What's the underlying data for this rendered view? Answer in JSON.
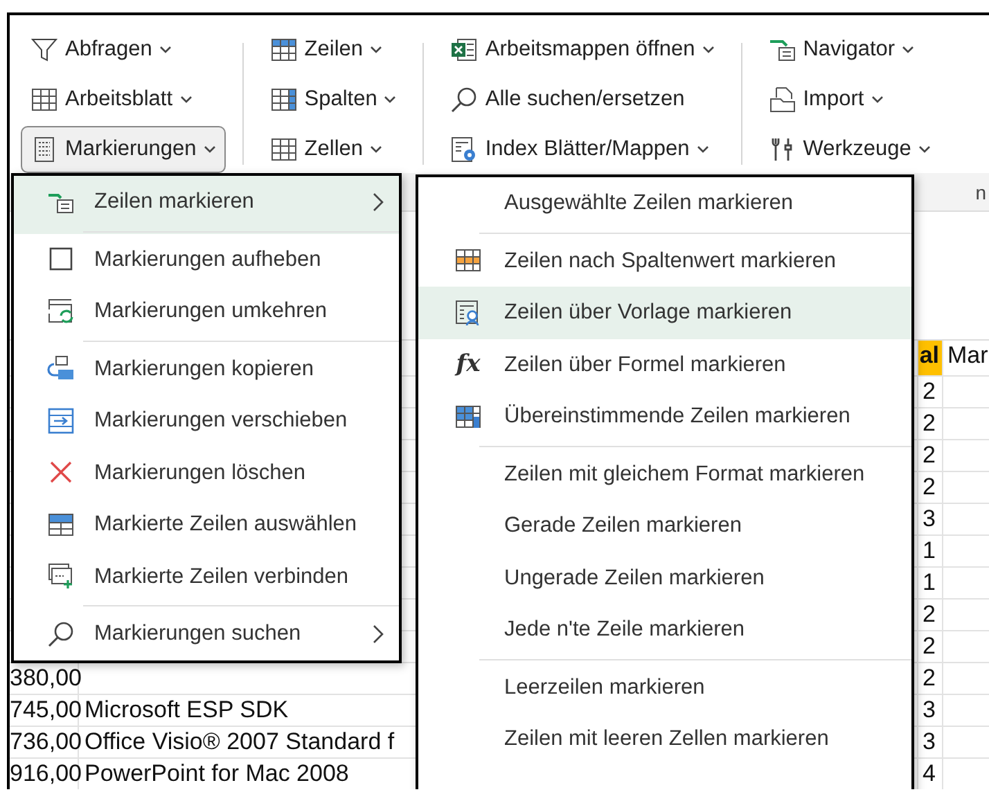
{
  "ribbon": {
    "groups": [
      {
        "items": [
          {
            "label": "Abfragen",
            "has_dropdown": true,
            "pressed": false
          },
          {
            "label": "Arbeitsblatt",
            "has_dropdown": true,
            "pressed": false
          },
          {
            "label": "Markierungen",
            "has_dropdown": true,
            "pressed": true
          }
        ]
      },
      {
        "items": [
          {
            "label": "Zeilen",
            "has_dropdown": true,
            "pressed": false
          },
          {
            "label": "Spalten",
            "has_dropdown": true,
            "pressed": false
          },
          {
            "label": "Zellen",
            "has_dropdown": true,
            "pressed": false
          }
        ]
      },
      {
        "items": [
          {
            "label": "Arbeitsmappen öffnen",
            "has_dropdown": true,
            "pressed": false
          },
          {
            "label": "Alle suchen/ersetzen",
            "has_dropdown": false,
            "pressed": false
          },
          {
            "label": "Index Blätter/Mappen",
            "has_dropdown": true,
            "pressed": false
          }
        ]
      },
      {
        "items": [
          {
            "label": "Navigator",
            "has_dropdown": true,
            "pressed": false
          },
          {
            "label": "Import",
            "has_dropdown": true,
            "pressed": false
          },
          {
            "label": "Werkzeuge",
            "has_dropdown": true,
            "pressed": false
          }
        ]
      }
    ],
    "group_label_fragments": [
      "n"
    ]
  },
  "sheet": {
    "headers": {
      "column_3": "al",
      "column_4": "Mar"
    },
    "rows": [
      {
        "column_3": "2"
      },
      {
        "column_3": "2"
      },
      {
        "column_3": "2"
      },
      {
        "column_3": "2"
      },
      {
        "column_3": "3"
      },
      {
        "column_3": "1"
      },
      {
        "column_3": "1"
      },
      {
        "column_3": "2"
      },
      {
        "column_3": "2"
      },
      {
        "column_1": "380,00",
        "column_3": "2"
      },
      {
        "column_1": "745,00",
        "column_2": "Microsoft ESP SDK",
        "column_3": "3"
      },
      {
        "column_1": "736,00",
        "column_2": "Office Visio® 2007 Standard f",
        "column_3": "3"
      },
      {
        "column_1": "916,00",
        "column_2": "PowerPoint for Mac 2008",
        "column_3": "4"
      }
    ]
  },
  "menus": [
    {
      "items": [
        {
          "label": "Zeilen markieren",
          "selected": true,
          "submenu": true,
          "separator_after": true
        },
        {
          "label": "Markierungen aufheben",
          "selected": false,
          "submenu": false,
          "separator_after": false
        },
        {
          "label": "Markierungen umkehren",
          "selected": false,
          "submenu": false,
          "separator_after": true
        },
        {
          "label": "Markierungen kopieren",
          "selected": false,
          "submenu": false,
          "separator_after": false
        },
        {
          "label": "Markierungen verschieben",
          "selected": false,
          "submenu": false,
          "separator_after": false
        },
        {
          "label": "Markierungen löschen",
          "selected": false,
          "submenu": false,
          "separator_after": false
        },
        {
          "label": "Markierte Zeilen auswählen",
          "selected": false,
          "submenu": false,
          "separator_after": false
        },
        {
          "label": "Markierte Zeilen verbinden",
          "selected": false,
          "submenu": false,
          "separator_after": true
        },
        {
          "label": "Markierungen suchen",
          "selected": false,
          "submenu": true,
          "separator_after": false
        }
      ]
    },
    {
      "items": [
        {
          "label": "Ausgewählte Zeilen markieren",
          "selected": false,
          "submenu": false,
          "separator_after": true
        },
        {
          "label": "Zeilen nach Spaltenwert markieren",
          "selected": false,
          "submenu": false,
          "separator_after": false
        },
        {
          "label": "Zeilen über Vorlage markieren",
          "selected": true,
          "submenu": false,
          "separator_after": false
        },
        {
          "label": "Zeilen über Formel markieren",
          "selected": false,
          "submenu": false,
          "separator_after": false,
          "icon_text": "fx"
        },
        {
          "label": "Übereinstimmende Zeilen markieren",
          "selected": false,
          "submenu": false,
          "separator_after": true
        },
        {
          "label": "Zeilen mit gleichem Format markieren",
          "selected": false,
          "submenu": false,
          "separator_after": false
        },
        {
          "label": "Gerade Zeilen markieren",
          "selected": false,
          "submenu": false,
          "separator_after": false
        },
        {
          "label": "Ungerade Zeilen markieren",
          "selected": false,
          "submenu": false,
          "separator_after": false
        },
        {
          "label": "Jede n'te Zeile markieren",
          "selected": false,
          "submenu": false,
          "separator_after": true
        },
        {
          "label": "Leerzeilen markieren",
          "selected": false,
          "submenu": false,
          "separator_after": false
        },
        {
          "label": "Zeilen mit leeren Zellen markieren",
          "selected": false,
          "submenu": false,
          "separator_after": false
        }
      ]
    }
  ]
}
